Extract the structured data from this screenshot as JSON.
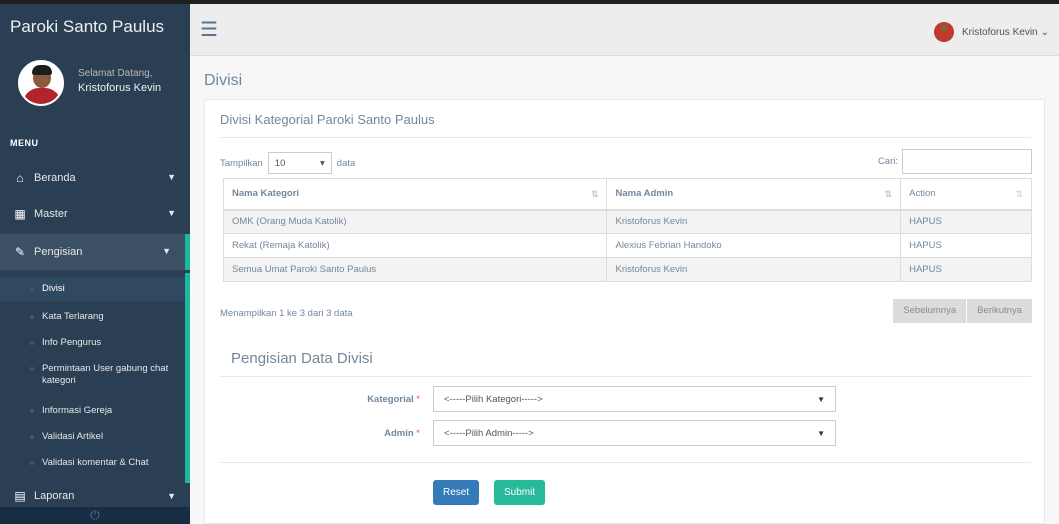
{
  "brand": "Paroki Santo Paulus",
  "profile": {
    "welcome": "Selamat Datang,",
    "name": "Kristoforus Kevin"
  },
  "menu_title": "MENU",
  "menu": {
    "beranda": "Beranda",
    "master": "Master",
    "pengisian": "Pengisian",
    "laporan": "Laporan"
  },
  "submenu": [
    "Divisi",
    "Kata Terlarang",
    "Info Pengurus",
    "Permintaan User gabung chat kategori",
    "Informasi Gereja",
    "Validasi Artikel",
    "Validasi komentar & Chat"
  ],
  "topnav": {
    "user": "Kristoforus Kevin"
  },
  "page_title": "Divisi",
  "panel_title": "Divisi Kategorial Paroki Santo Paulus",
  "table_controls": {
    "show_prefix": "Tampilkan",
    "length": "10",
    "show_suffix": "data",
    "search_label": "Cari:"
  },
  "table": {
    "headers": [
      "Nama Kategori",
      "Nama Admin",
      "Action"
    ],
    "rows": [
      [
        "OMK (Orang Muda Katolik)",
        "Kristoforus Kevin",
        "HAPUS"
      ],
      [
        "Rekat (Remaja Katolik)",
        "Alexius Febrian Handoko",
        "HAPUS"
      ],
      [
        "Semua Umat Paroki Santo Paulus",
        "Kristoforus Kevin",
        "HAPUS"
      ]
    ]
  },
  "info": "Menampilkan 1 ke 3 dari 3 data",
  "pager": {
    "prev": "Sebelumnya",
    "next": "Berikutnya"
  },
  "form": {
    "title": "Pengisian Data Divisi",
    "kategorial_label": "Kategorial",
    "kategorial_value": "<-----Pilih Kategori----->",
    "admin_label": "Admin",
    "admin_value": "<-----Pilih Admin----->",
    "required": "*",
    "reset": "Reset",
    "submit": "Submit"
  },
  "colors": {
    "sidebar": "#2a3f54",
    "accent": "#1abb9c",
    "reset": "#337ab7",
    "submit": "#26b99a"
  }
}
